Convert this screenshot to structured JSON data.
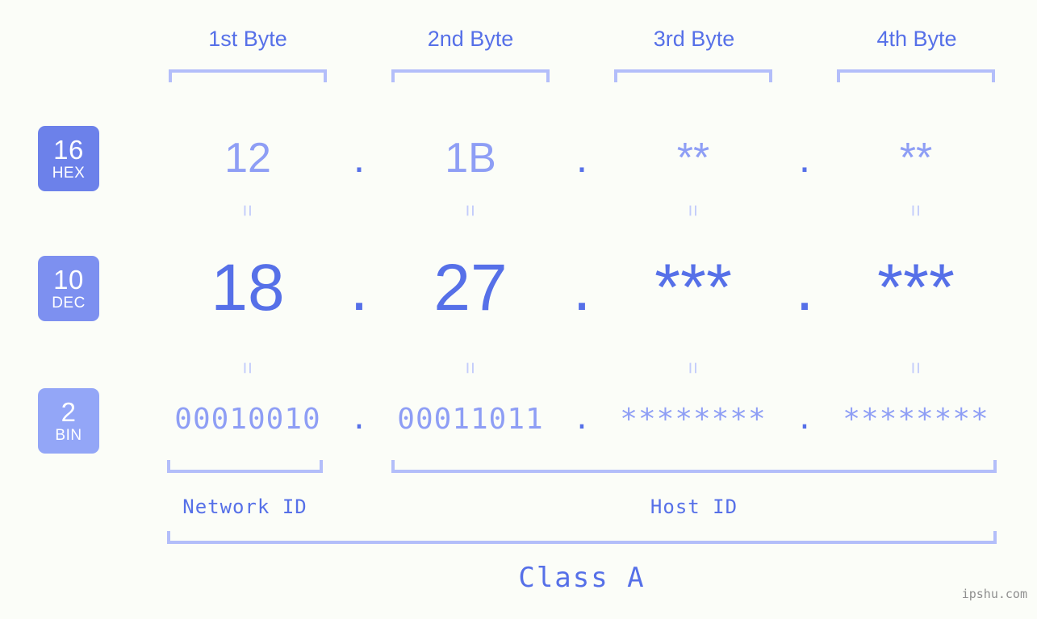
{
  "background_color": "#fbfdf8",
  "accent_strong": "#5670e8",
  "accent_mid": "#8e9ef5",
  "accent_light": "#b3befa",
  "byte_headers": [
    {
      "label": "1st Byte"
    },
    {
      "label": "2nd Byte"
    },
    {
      "label": "3rd Byte"
    },
    {
      "label": "4th Byte"
    }
  ],
  "bases": [
    {
      "num": "16",
      "label": "HEX",
      "color": "#6c81ea"
    },
    {
      "num": "10",
      "label": "DEC",
      "color": "#7d90f0"
    },
    {
      "num": "2",
      "label": "BIN",
      "color": "#93a6f7"
    }
  ],
  "rows": {
    "hex": {
      "values": [
        "12",
        "1B",
        "**",
        "**"
      ],
      "separator": "."
    },
    "dec": {
      "values": [
        "18",
        "27",
        "***",
        "***"
      ],
      "separator": "."
    },
    "bin": {
      "values": [
        "00010010",
        "00011011",
        "********",
        "********"
      ],
      "separator": "."
    }
  },
  "equals_symbol": "=",
  "footer": {
    "network_id_label": "Network ID",
    "host_id_label": "Host ID",
    "class_label": "Class A"
  },
  "watermark": "ipshu.com"
}
